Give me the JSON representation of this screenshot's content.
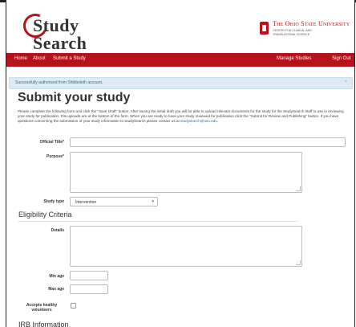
{
  "header": {
    "logo_line1": "Study",
    "logo_line2": "Search",
    "osu_name": "The Ohio State University",
    "osu_sub_line1": "CENTER FOR CLINICAL AND",
    "osu_sub_line2": "TRANSLATIONAL SCIENCE"
  },
  "nav": {
    "home": "Home",
    "about": "About",
    "submit": "Submit a Study",
    "manage": "Manage Studies",
    "signout": "Sign Out"
  },
  "alert": {
    "text": "Successfully authorized from Shibboleth account.",
    "close": "×"
  },
  "page": {
    "title": "Submit your study",
    "intro": "Please complete the following form and click the \"Save Draft\" button. After saving the initial draft you will be able to upload relevant documents for the study for the StudySearch staff to use in reviewing your study for publication. File uploads are at the bottom of the form. When you are ready to have your study reviewed for publication click the \"Submit for Review and Publishing\" button. If you have questions concerning the submission of your study information to StudySearch please contact us at",
    "email": "studysearch@osu.edu",
    "intro_end": "."
  },
  "form": {
    "official_title_label": "Official Title*",
    "purpose_label": "Purpose*",
    "study_type_label": "Study type",
    "study_type_value": "Intervention",
    "eligibility_heading": "Eligibility Criteria",
    "details_label": "Details",
    "min_age_label": "Min age",
    "max_age_label": "Max age",
    "healthy_label_1": "Accepts healthy",
    "healthy_label_2": "volunteers",
    "irb_heading": "IRB Information"
  },
  "colors": {
    "brand_red": "#b5121b",
    "alert_bg": "#dcecf2"
  }
}
